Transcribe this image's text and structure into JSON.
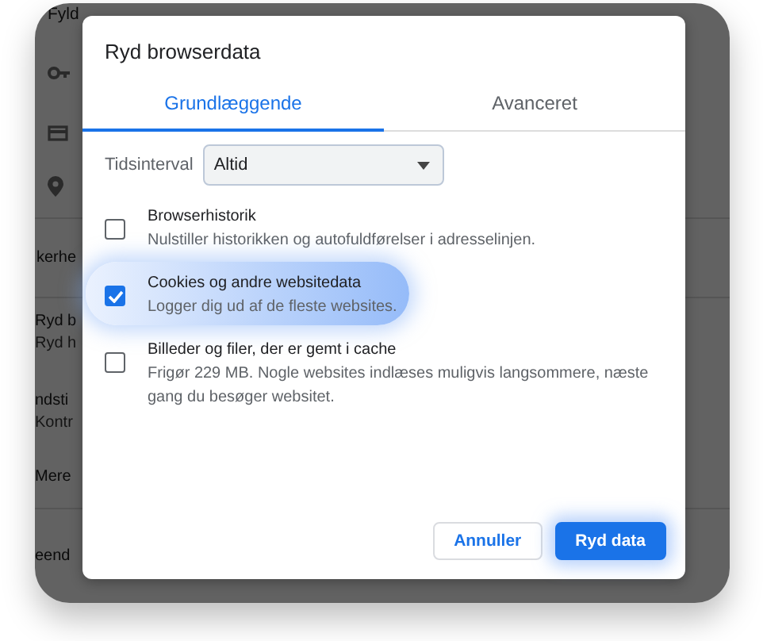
{
  "background": {
    "title": "Fyld",
    "items": [
      {
        "title": "kerhe"
      },
      {
        "title": "Ryd b",
        "subtitle": "Ryd h"
      },
      {
        "title": "ndsti",
        "subtitle": "Kontr"
      },
      {
        "title": "Mere"
      },
      {
        "title": "eend"
      }
    ]
  },
  "dialog": {
    "title": "Ryd browserdata",
    "tabs": [
      {
        "label": "Grundlæggende",
        "selected": true
      },
      {
        "label": "Avanceret",
        "selected": false
      }
    ],
    "time_range": {
      "label": "Tidsinterval",
      "value": "Altid"
    },
    "options": [
      {
        "title": "Browserhistorik",
        "description": "Nulstiller historikken og autofuldførelser i adresselinjen.",
        "checked": false,
        "highlighted": false
      },
      {
        "title": "Cookies og andre websitedata",
        "description": "Logger dig ud af de fleste websites.",
        "checked": true,
        "highlighted": true
      },
      {
        "title": "Billeder og filer, der er gemt i cache",
        "description": "Frigør 229 MB. Nogle websites indlæses muligvis langsommere, næste gang du besøger websitet.",
        "checked": false,
        "highlighted": false
      }
    ],
    "buttons": [
      {
        "label": "Annuller",
        "kind": "secondary"
      },
      {
        "label": "Ryd data",
        "kind": "primary"
      }
    ]
  }
}
